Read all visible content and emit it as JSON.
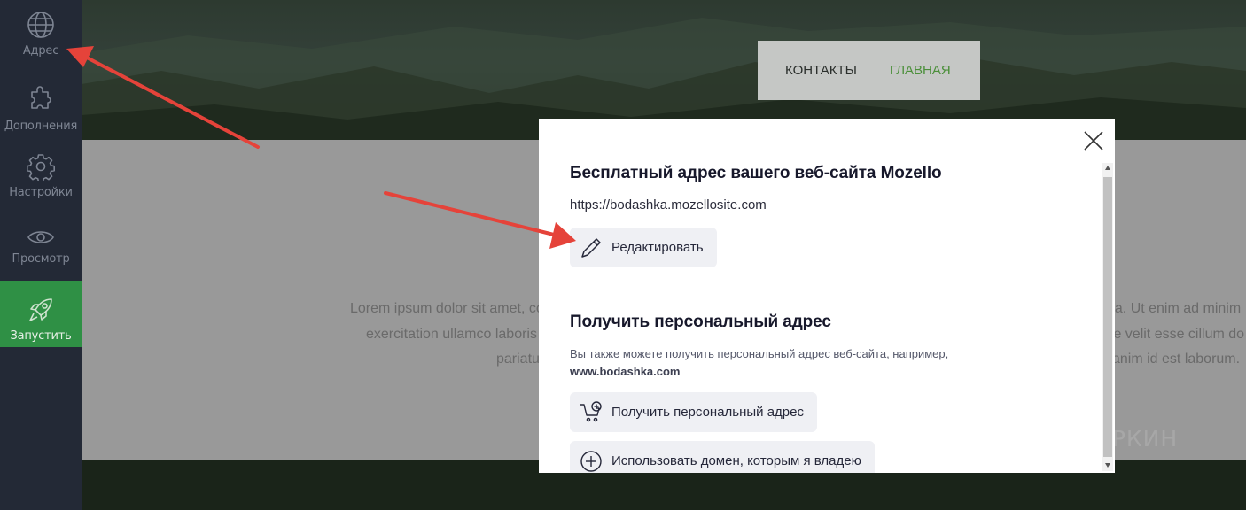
{
  "sidebar": {
    "items": [
      {
        "label": "Адрес",
        "icon": "globe-icon"
      },
      {
        "label": "Дополнения",
        "icon": "puzzle-icon"
      },
      {
        "label": "Настройки",
        "icon": "gear-icon"
      },
      {
        "label": "Просмотр",
        "icon": "eye-icon"
      },
      {
        "label": "Запустить",
        "icon": "rocket-icon"
      }
    ]
  },
  "site": {
    "nav": {
      "contacts": "КОНТАКТЫ",
      "home": "ГЛАВНАЯ"
    },
    "lorem_left": [
      "Lorem ipsum dolor sit amet, co",
      "exercitation ullamco laboris",
      "pariatu"
    ],
    "lorem_right": [
      "ua. Ut enim ad minim",
      "te velit esse cillum do",
      "anim id est laborum."
    ]
  },
  "modal": {
    "free_title": "Бесплатный адрес вашего веб-сайта Mozello",
    "free_url": "https://bodashka.mozellosite.com",
    "edit_label": "Редактировать",
    "personal_title": "Получить персональный адрес",
    "personal_desc": "Вы также можете получить персональный адрес веб-сайта, например,",
    "personal_example": "www.bodashka.com",
    "get_address_label": "Получить персональный адрес",
    "own_domain_label": "Использовать домен, которым я владею"
  },
  "watermark": {
    "text": "ПАРТНЕРКИН"
  },
  "colors": {
    "sidebar_bg": "#232936",
    "launch_bg": "#2f9045",
    "nav_home": "#4b8f3a",
    "arrow": "#e5433a"
  }
}
